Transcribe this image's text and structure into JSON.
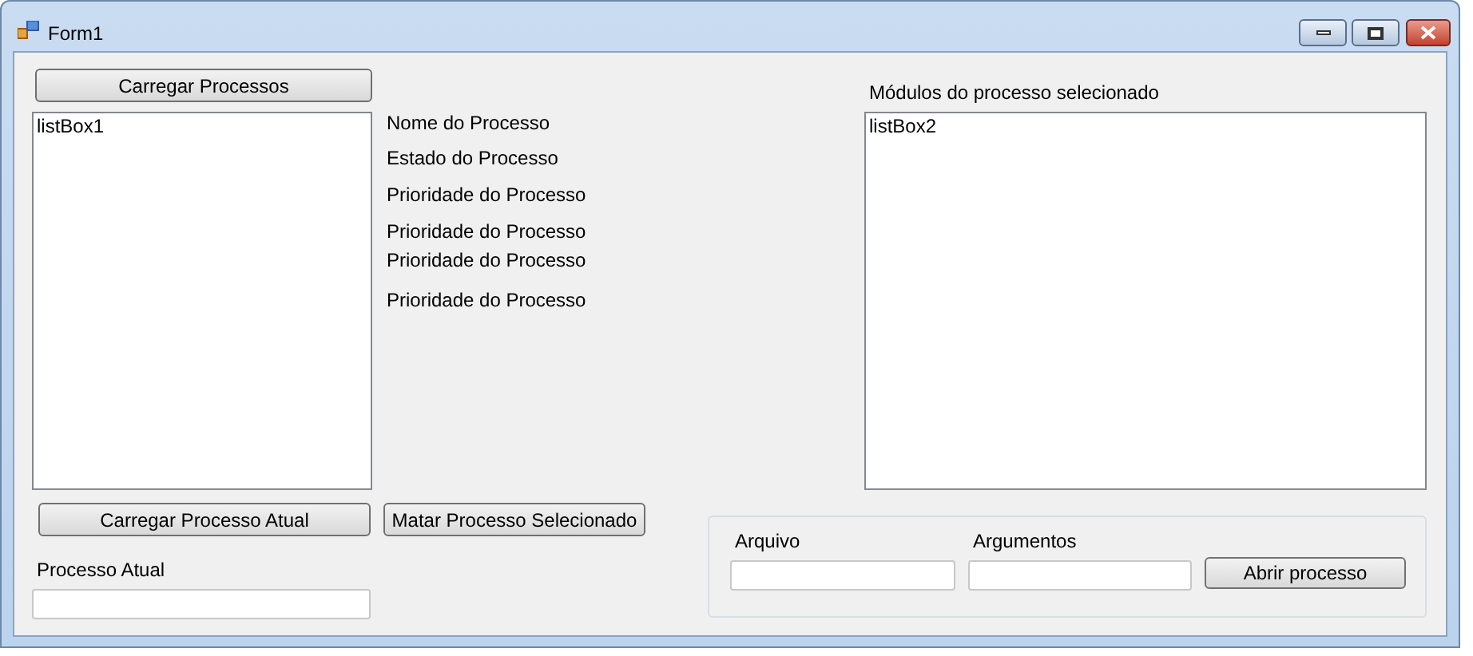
{
  "window": {
    "title": "Form1"
  },
  "load_button": "Carregar Processos",
  "list_box_1": {
    "items": [
      "listBox1"
    ]
  },
  "info_labels": [
    "Nome do Processo",
    "Estado do Processo",
    "Prioridade do Processo",
    "Prioridade do Processo",
    "Prioridade do Processo",
    "Prioridade do Processo"
  ],
  "modules_label": "Módulos do processo selecionado",
  "list_box_2": {
    "items": [
      "listBox2"
    ]
  },
  "current_button": "Carregar Processo Atual",
  "kill_button": "Matar Processo Selecionado",
  "current_label": "Processo Atual",
  "open_group": {
    "file_label": "Arquivo",
    "args_label": "Argumentos",
    "open_button": "Abrir processo"
  }
}
